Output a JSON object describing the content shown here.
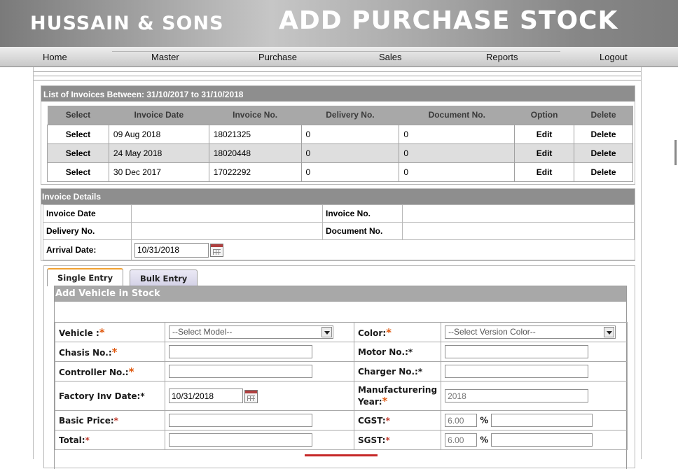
{
  "header": {
    "company": "HUSSAIN & SONS",
    "title": "ADD PURCHASE STOCK"
  },
  "nav": [
    "Home",
    "Master",
    "Purchase",
    "Sales",
    "Reports",
    "Logout"
  ],
  "invoice_list": {
    "title": "List of Invoices Between: 31/10/2017 to 31/10/2018",
    "columns": [
      "Select",
      "Invoice Date",
      "Invoice No.",
      "Delivery No.",
      "Document No.",
      "Option",
      "Delete"
    ],
    "rows": [
      {
        "select": "Select",
        "date": "09 Aug 2018",
        "invoice_no": "18021325",
        "delivery_no": "0",
        "document_no": "0",
        "option": "Edit",
        "delete": "Delete"
      },
      {
        "select": "Select",
        "date": "24 May 2018",
        "invoice_no": "18020448",
        "delivery_no": "0",
        "document_no": "0",
        "option": "Edit",
        "delete": "Delete"
      },
      {
        "select": "Select",
        "date": "30 Dec 2017",
        "invoice_no": "17022292",
        "delivery_no": "0",
        "document_no": "0",
        "option": "Edit",
        "delete": "Delete"
      }
    ]
  },
  "invoice_details": {
    "title": "Invoice Details",
    "invoice_date_label": "Invoice Date",
    "invoice_no_label": "Invoice No.",
    "delivery_no_label": "Delivery No.",
    "document_no_label": "Document No.",
    "arrival_date_label": "Arrival Date:",
    "arrival_date_value": "10/31/2018"
  },
  "tabs": {
    "single": "Single Entry",
    "bulk": "Bulk Entry"
  },
  "entry": {
    "title": "Add Vehicle in Stock",
    "vehicle_label": "Vehicle :",
    "vehicle_select": "--Select Model--",
    "color_label": "Color:",
    "color_select": "--Select Version Color--",
    "chasis_label": "Chasis No.:",
    "motor_label": "Motor No.:*",
    "controller_label": "Controller No.:",
    "charger_label": "Charger No.:*",
    "factory_date_label": "Factory Inv Date:*",
    "factory_date_value": "10/31/2018",
    "mfg_year_label": "Manufacturering Year:",
    "mfg_year_value": "2018",
    "basic_price_label": "Basic Price:",
    "cgst_label": "CGST:",
    "cgst_rate": "6.00",
    "total_label": "Total:",
    "sgst_label": "SGST:",
    "sgst_rate": "6.00",
    "percent": "%",
    "asterisk": "*"
  }
}
